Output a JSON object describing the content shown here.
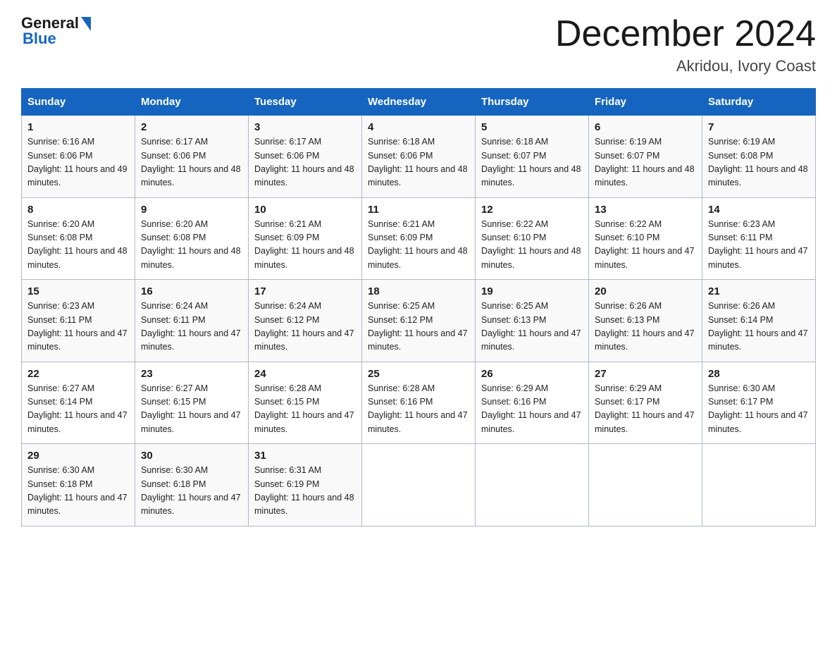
{
  "header": {
    "logo_general": "General",
    "logo_blue": "Blue",
    "main_title": "December 2024",
    "subtitle": "Akridou, Ivory Coast"
  },
  "days_of_week": [
    "Sunday",
    "Monday",
    "Tuesday",
    "Wednesday",
    "Thursday",
    "Friday",
    "Saturday"
  ],
  "weeks": [
    [
      {
        "num": "1",
        "sunrise": "6:16 AM",
        "sunset": "6:06 PM",
        "daylight": "11 hours and 49 minutes."
      },
      {
        "num": "2",
        "sunrise": "6:17 AM",
        "sunset": "6:06 PM",
        "daylight": "11 hours and 48 minutes."
      },
      {
        "num": "3",
        "sunrise": "6:17 AM",
        "sunset": "6:06 PM",
        "daylight": "11 hours and 48 minutes."
      },
      {
        "num": "4",
        "sunrise": "6:18 AM",
        "sunset": "6:06 PM",
        "daylight": "11 hours and 48 minutes."
      },
      {
        "num": "5",
        "sunrise": "6:18 AM",
        "sunset": "6:07 PM",
        "daylight": "11 hours and 48 minutes."
      },
      {
        "num": "6",
        "sunrise": "6:19 AM",
        "sunset": "6:07 PM",
        "daylight": "11 hours and 48 minutes."
      },
      {
        "num": "7",
        "sunrise": "6:19 AM",
        "sunset": "6:08 PM",
        "daylight": "11 hours and 48 minutes."
      }
    ],
    [
      {
        "num": "8",
        "sunrise": "6:20 AM",
        "sunset": "6:08 PM",
        "daylight": "11 hours and 48 minutes."
      },
      {
        "num": "9",
        "sunrise": "6:20 AM",
        "sunset": "6:08 PM",
        "daylight": "11 hours and 48 minutes."
      },
      {
        "num": "10",
        "sunrise": "6:21 AM",
        "sunset": "6:09 PM",
        "daylight": "11 hours and 48 minutes."
      },
      {
        "num": "11",
        "sunrise": "6:21 AM",
        "sunset": "6:09 PM",
        "daylight": "11 hours and 48 minutes."
      },
      {
        "num": "12",
        "sunrise": "6:22 AM",
        "sunset": "6:10 PM",
        "daylight": "11 hours and 48 minutes."
      },
      {
        "num": "13",
        "sunrise": "6:22 AM",
        "sunset": "6:10 PM",
        "daylight": "11 hours and 47 minutes."
      },
      {
        "num": "14",
        "sunrise": "6:23 AM",
        "sunset": "6:11 PM",
        "daylight": "11 hours and 47 minutes."
      }
    ],
    [
      {
        "num": "15",
        "sunrise": "6:23 AM",
        "sunset": "6:11 PM",
        "daylight": "11 hours and 47 minutes."
      },
      {
        "num": "16",
        "sunrise": "6:24 AM",
        "sunset": "6:11 PM",
        "daylight": "11 hours and 47 minutes."
      },
      {
        "num": "17",
        "sunrise": "6:24 AM",
        "sunset": "6:12 PM",
        "daylight": "11 hours and 47 minutes."
      },
      {
        "num": "18",
        "sunrise": "6:25 AM",
        "sunset": "6:12 PM",
        "daylight": "11 hours and 47 minutes."
      },
      {
        "num": "19",
        "sunrise": "6:25 AM",
        "sunset": "6:13 PM",
        "daylight": "11 hours and 47 minutes."
      },
      {
        "num": "20",
        "sunrise": "6:26 AM",
        "sunset": "6:13 PM",
        "daylight": "11 hours and 47 minutes."
      },
      {
        "num": "21",
        "sunrise": "6:26 AM",
        "sunset": "6:14 PM",
        "daylight": "11 hours and 47 minutes."
      }
    ],
    [
      {
        "num": "22",
        "sunrise": "6:27 AM",
        "sunset": "6:14 PM",
        "daylight": "11 hours and 47 minutes."
      },
      {
        "num": "23",
        "sunrise": "6:27 AM",
        "sunset": "6:15 PM",
        "daylight": "11 hours and 47 minutes."
      },
      {
        "num": "24",
        "sunrise": "6:28 AM",
        "sunset": "6:15 PM",
        "daylight": "11 hours and 47 minutes."
      },
      {
        "num": "25",
        "sunrise": "6:28 AM",
        "sunset": "6:16 PM",
        "daylight": "11 hours and 47 minutes."
      },
      {
        "num": "26",
        "sunrise": "6:29 AM",
        "sunset": "6:16 PM",
        "daylight": "11 hours and 47 minutes."
      },
      {
        "num": "27",
        "sunrise": "6:29 AM",
        "sunset": "6:17 PM",
        "daylight": "11 hours and 47 minutes."
      },
      {
        "num": "28",
        "sunrise": "6:30 AM",
        "sunset": "6:17 PM",
        "daylight": "11 hours and 47 minutes."
      }
    ],
    [
      {
        "num": "29",
        "sunrise": "6:30 AM",
        "sunset": "6:18 PM",
        "daylight": "11 hours and 47 minutes."
      },
      {
        "num": "30",
        "sunrise": "6:30 AM",
        "sunset": "6:18 PM",
        "daylight": "11 hours and 47 minutes."
      },
      {
        "num": "31",
        "sunrise": "6:31 AM",
        "sunset": "6:19 PM",
        "daylight": "11 hours and 48 minutes."
      },
      null,
      null,
      null,
      null
    ]
  ]
}
